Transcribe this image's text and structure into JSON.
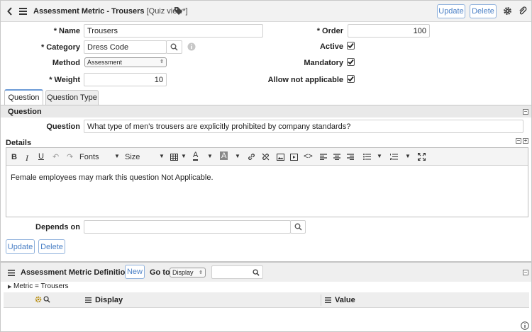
{
  "header": {
    "title": "Assessment Metric - Trousers",
    "view": "[Quiz view*]",
    "update_label": "Update",
    "delete_label": "Delete"
  },
  "form": {
    "name_label": "* Name",
    "name_value": "Trousers",
    "category_label": "* Category",
    "category_value": "Dress Code",
    "method_label": "Method",
    "method_value": "Assessment",
    "weight_label": "* Weight",
    "weight_value": "10",
    "order_label": "* Order",
    "order_value": "100",
    "active_label": "Active",
    "active_checked": true,
    "mandatory_label": "Mandatory",
    "mandatory_checked": true,
    "allow_na_label": "Allow not applicable",
    "allow_na_checked": true
  },
  "tabs": [
    {
      "label": "Question",
      "active": true
    },
    {
      "label": "Question Type",
      "active": false
    }
  ],
  "question_section": {
    "header": "Question",
    "question_label": "Question",
    "question_value": "What type of men's trousers are explicitly prohibited by company standards?",
    "details_label": "Details",
    "fonts_label": "Fonts",
    "size_label": "Size",
    "details_body": "Female employees may mark this question Not Applicable.",
    "depends_on_label": "Depends on",
    "depends_on_value": ""
  },
  "bottom_buttons": {
    "update_label": "Update",
    "delete_label": "Delete"
  },
  "related_list": {
    "title": "Assessment Metric Definitions",
    "new_label": "New",
    "goto_label": "Go to",
    "goto_select": "Display",
    "search_value": "",
    "breadcrumb": "Metric = Trousers",
    "columns": [
      "Display",
      "Value"
    ]
  },
  "colors": {
    "accent": "#4b80c6",
    "header_bg": "#f2f2f2",
    "section_bg": "#e9e9e9"
  }
}
